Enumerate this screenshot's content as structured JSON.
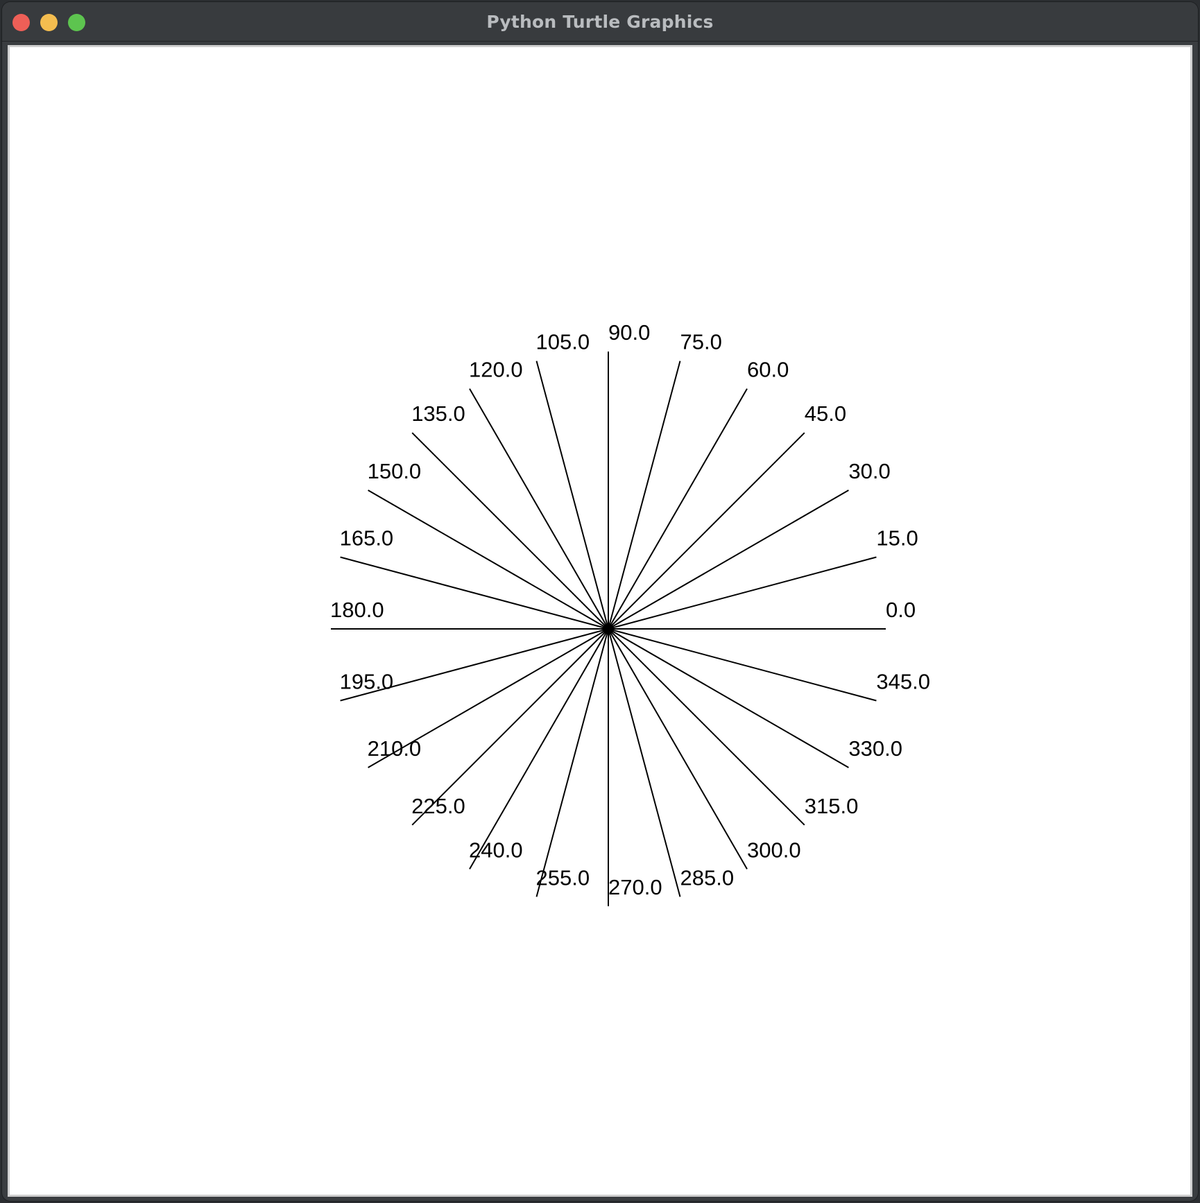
{
  "window": {
    "title": "Python Turtle Graphics"
  },
  "titlebar_buttons": {
    "close_color": "#ee5f57",
    "minimize_color": "#f4bd4f",
    "zoom_color": "#5dc44f"
  },
  "canvas": {
    "background": "#ffffff",
    "line_color": "#000000",
    "angles": [
      0,
      15,
      30,
      45,
      60,
      75,
      90,
      105,
      120,
      135,
      150,
      165,
      180,
      195,
      210,
      225,
      240,
      255,
      270,
      285,
      300,
      315,
      330,
      345
    ],
    "labels": [
      "0.0",
      "15.0",
      "30.0",
      "45.0",
      "60.0",
      "75.0",
      "90.0",
      "105.0",
      "120.0",
      "135.0",
      "150.0",
      "165.0",
      "180.0",
      "195.0",
      "210.0",
      "225.0",
      "240.0",
      "255.0",
      "270.0",
      "285.0",
      "300.0",
      "315.0",
      "330.0",
      "345.0"
    ]
  }
}
